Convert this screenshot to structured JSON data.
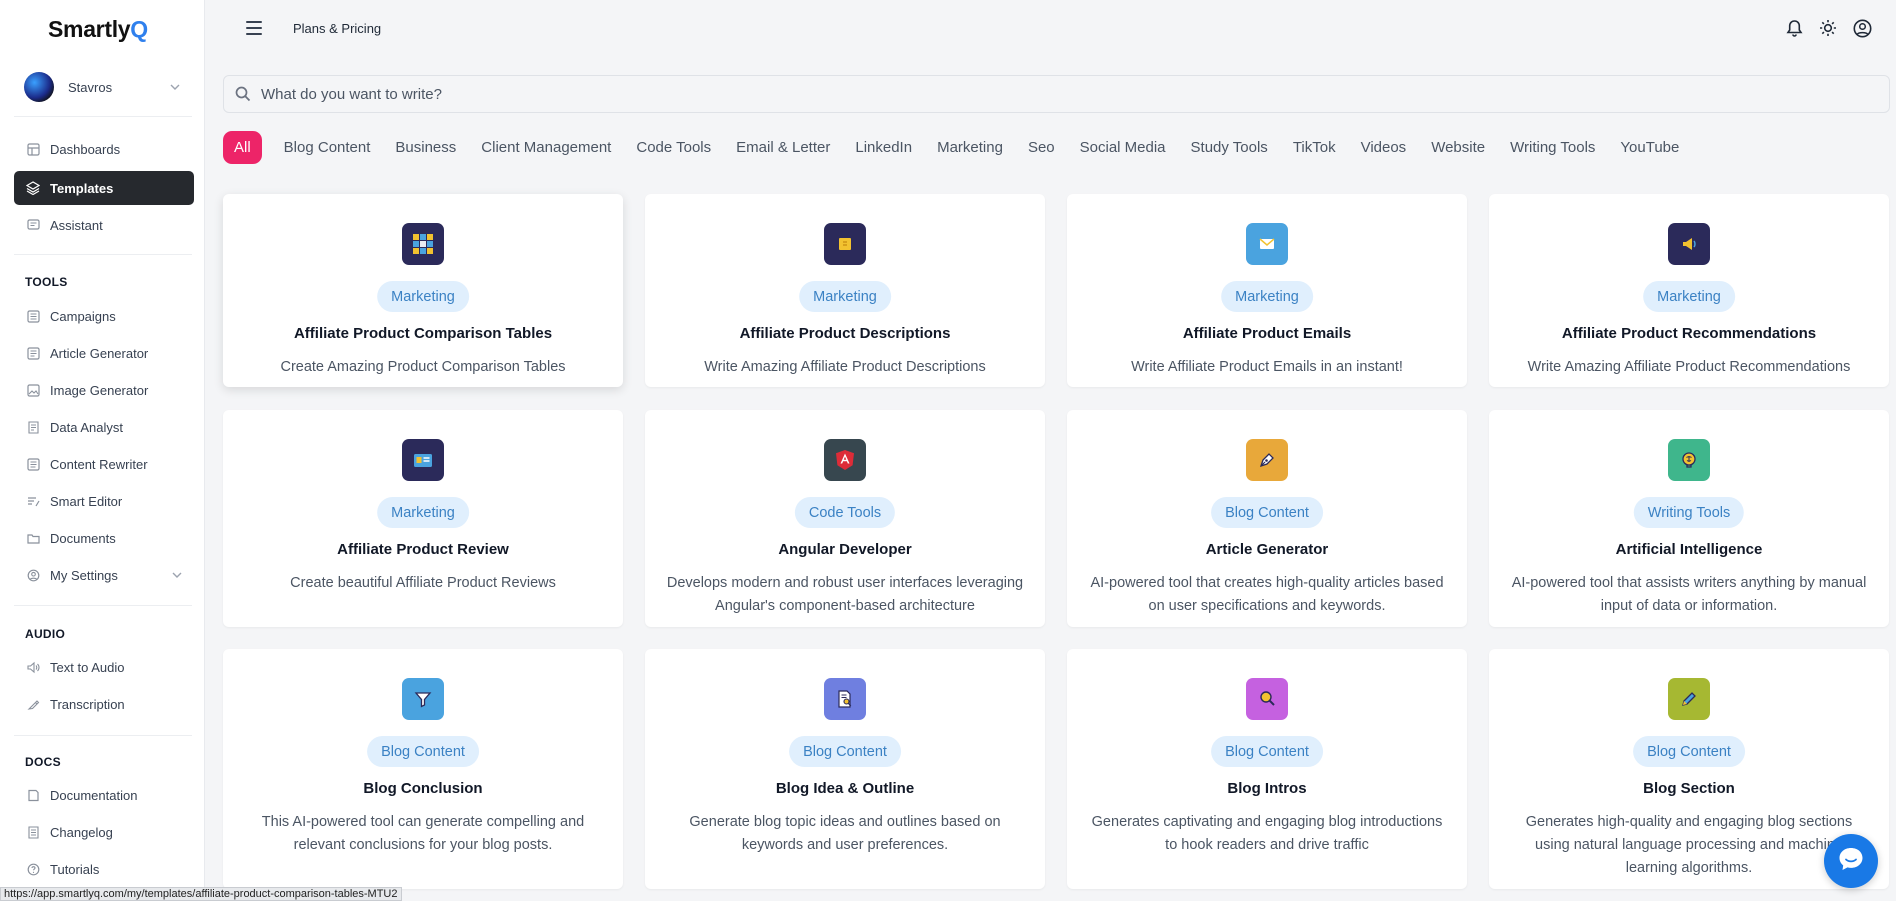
{
  "app": {
    "logo_main": "Smartly",
    "logo_accent": "Q"
  },
  "user": {
    "name": "Stavros"
  },
  "nav": {
    "main": [
      {
        "label": "Dashboards",
        "icon": "dashboard-icon"
      },
      {
        "label": "Templates",
        "icon": "layers-icon",
        "active": true
      },
      {
        "label": "Assistant",
        "icon": "chat-icon"
      }
    ],
    "tools_title": "TOOLS",
    "tools": [
      {
        "label": "Campaigns",
        "icon": "campaigns-icon"
      },
      {
        "label": "Article Generator",
        "icon": "article-icon"
      },
      {
        "label": "Image Generator",
        "icon": "image-icon"
      },
      {
        "label": "Data Analyst",
        "icon": "data-icon"
      },
      {
        "label": "Content Rewriter",
        "icon": "rewrite-icon"
      },
      {
        "label": "Smart Editor",
        "icon": "editor-icon"
      },
      {
        "label": "Documents",
        "icon": "folder-icon"
      },
      {
        "label": "My Settings",
        "icon": "settings-icon"
      }
    ],
    "audio_title": "AUDIO",
    "audio": [
      {
        "label": "Text to Audio",
        "icon": "speaker-icon"
      },
      {
        "label": "Transcription",
        "icon": "transcription-icon"
      }
    ],
    "docs_title": "DOCS",
    "docs": [
      {
        "label": "Documentation",
        "icon": "book-icon"
      },
      {
        "label": "Changelog",
        "icon": "changelog-icon"
      },
      {
        "label": "Tutorials",
        "icon": "help-icon"
      }
    ]
  },
  "topbar": {
    "link": "Plans & Pricing"
  },
  "search": {
    "placeholder": "What do you want to write?"
  },
  "tabs": [
    "All",
    "Blog Content",
    "Business",
    "Client Management",
    "Code Tools",
    "Email & Letter",
    "LinkedIn",
    "Marketing",
    "Seo",
    "Social Media",
    "Study Tools",
    "TikTok",
    "Videos",
    "Website",
    "Writing Tools",
    "YouTube"
  ],
  "cards": [
    {
      "category": "Marketing",
      "title": "Affiliate Product Comparison Tables",
      "desc": "Create Amazing Product Comparison Tables",
      "icon": "grid-icon",
      "color": "#2b2a5a"
    },
    {
      "category": "Marketing",
      "title": "Affiliate Product Descriptions",
      "desc": "Write Amazing Affiliate Product Descriptions",
      "icon": "sticky-note-icon",
      "color": "#2b2a5a"
    },
    {
      "category": "Marketing",
      "title": "Affiliate Product Emails",
      "desc": "Write Affiliate Product Emails in an instant!",
      "icon": "envelope-icon",
      "color": "#4aa3df"
    },
    {
      "category": "Marketing",
      "title": "Affiliate Product Recommendations",
      "desc": "Write Amazing Affiliate Product Recommendations",
      "icon": "megaphone-icon",
      "color": "#2b2a5a"
    },
    {
      "category": "Marketing",
      "title": "Affiliate Product Review",
      "desc": "Create beautiful Affiliate Product Reviews",
      "icon": "id-card-icon",
      "color": "#2b2a5a"
    },
    {
      "category": "Code Tools",
      "title": "Angular Developer",
      "desc": "Develops modern and robust user interfaces leveraging Angular's component-based architecture",
      "icon": "angular-icon",
      "color": "#37474f"
    },
    {
      "category": "Blog Content",
      "title": "Article Generator",
      "desc": "AI-powered tool that creates high-quality articles based on user specifications and keywords.",
      "icon": "pen-nib-icon",
      "color": "#e8a83a"
    },
    {
      "category": "Writing Tools",
      "title": "Artificial Intelligence",
      "desc": "AI-powered tool that assists writers anything by manual input of data or information.",
      "icon": "brain-icon",
      "color": "#3fb68c"
    },
    {
      "category": "Blog Content",
      "title": "Blog Conclusion",
      "desc": "This AI-powered tool can generate compelling and relevant conclusions for your blog posts.",
      "icon": "filter-icon",
      "color": "#4aa3df"
    },
    {
      "category": "Blog Content",
      "title": "Blog Idea & Outline",
      "desc": "Generate blog topic ideas and outlines based on keywords and user preferences.",
      "icon": "document-search-icon",
      "color": "#6f7fe0"
    },
    {
      "category": "Blog Content",
      "title": "Blog Intros",
      "desc": "Generates captivating and engaging blog introductions to hook readers and drive traffic",
      "icon": "magnifier-icon",
      "color": "#c561e0"
    },
    {
      "category": "Blog Content",
      "title": "Blog Section",
      "desc": "Generates high-quality and engaging blog sections using natural language processing and machine learning algorithms.",
      "icon": "pencil-icon",
      "color": "#a6b832"
    }
  ],
  "status_url": "https://app.smartlyq.com/my/templates/affiliate-product-comparison-tables-MTU2"
}
